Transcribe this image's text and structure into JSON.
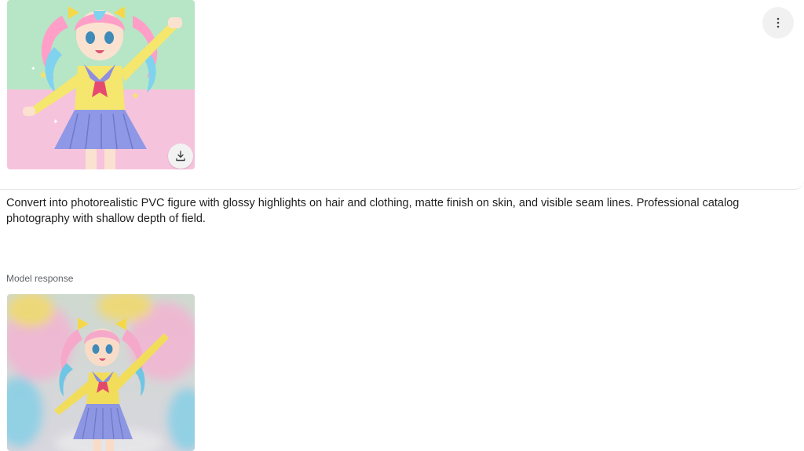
{
  "user_turn": {
    "input_image": {
      "alt": "Anime girl illustration",
      "icon": "anime-character-illustration"
    },
    "download_icon": "download-icon",
    "more_icon": "more-vert-icon",
    "prompt": "Convert into photorealistic PVC figure with glossy highlights on hair and clothing, matte finish on skin, and visible seam lines. Professional catalog photography with shallow depth of field."
  },
  "response": {
    "label": "Model response",
    "output_image": {
      "alt": "Generated PVC figure photo",
      "icon": "pvc-figure-photo"
    }
  },
  "colors": {
    "background_green": "#b6e6c5",
    "background_pink": "#f6c3dd",
    "label_gray": "#5f6368"
  }
}
